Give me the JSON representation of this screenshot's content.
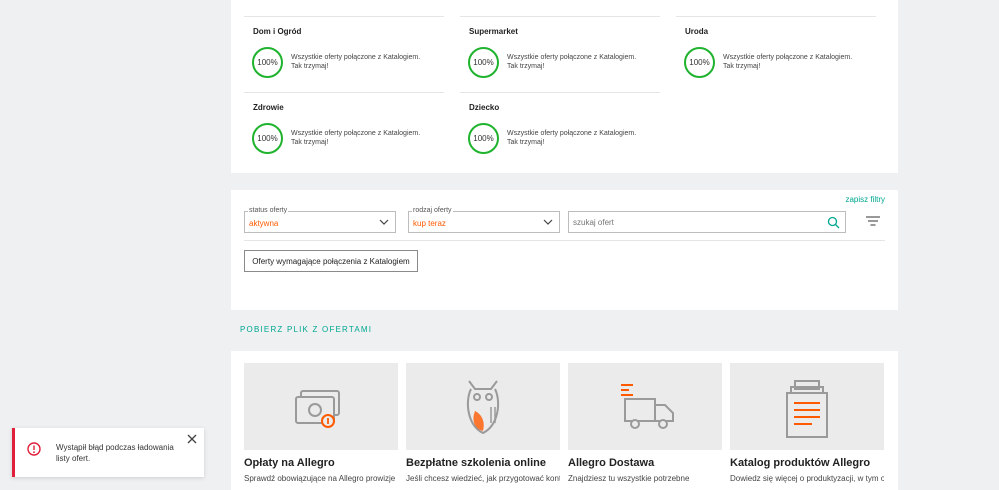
{
  "categories": [
    {
      "title": "Dom i Ogród",
      "percent": "100%",
      "text1": "Wszystkie oferty połączone z Katalogiem.",
      "text2": "Tak trzymaj!"
    },
    {
      "title": "Supermarket",
      "percent": "100%",
      "text1": "Wszystkie oferty połączone z Katalogiem.",
      "text2": "Tak trzymaj!"
    },
    {
      "title": "Uroda",
      "percent": "100%",
      "text1": "Wszystkie oferty połączone z Katalogiem.",
      "text2": "Tak trzymaj!"
    },
    {
      "title": "Zdrowie",
      "percent": "100%",
      "text1": "Wszystkie oferty połączone z Katalogiem.",
      "text2": "Tak trzymaj!"
    },
    {
      "title": "Dziecko",
      "percent": "100%",
      "text1": "Wszystkie oferty połączone z Katalogiem.",
      "text2": "Tak trzymaj!"
    }
  ],
  "filters": {
    "save_label": "zapisz filtry",
    "status": {
      "label": "status oferty",
      "value": "aktywna"
    },
    "type": {
      "label": "rodzaj oferty",
      "value": "kup teraz"
    },
    "search_placeholder": "szukaj ofert",
    "catalog_button": "Oferty wymagające połączenia z Katalogiem"
  },
  "download_label": "POBIERZ PLIK Z OFERTAMI",
  "tiles": [
    {
      "title": "Opłaty na Allegro",
      "desc": "Sprawdź obowiązujące na Allegro prowizje",
      "icon": "money-icon"
    },
    {
      "title": "Bezpłatne szkolenia online",
      "desc": "Jeśli chcesz wiedzieć, jak przygotować konto",
      "icon": "owl-icon"
    },
    {
      "title": "Allegro Dostawa",
      "desc": "Znajdziesz tu wszystkie potrzebne",
      "icon": "truck-icon"
    },
    {
      "title": "Katalog produktów Allegro",
      "desc": "Dowiedz się więcej o produktyzacji, w tym o",
      "icon": "catalog-icon"
    }
  ],
  "toast": {
    "message": "Wystąpił błąd podczas ładowania listy ofert."
  },
  "colors": {
    "accent": "#00a790",
    "orange": "#ff5a00",
    "success": "#1fb32e",
    "error": "#e0203a"
  }
}
